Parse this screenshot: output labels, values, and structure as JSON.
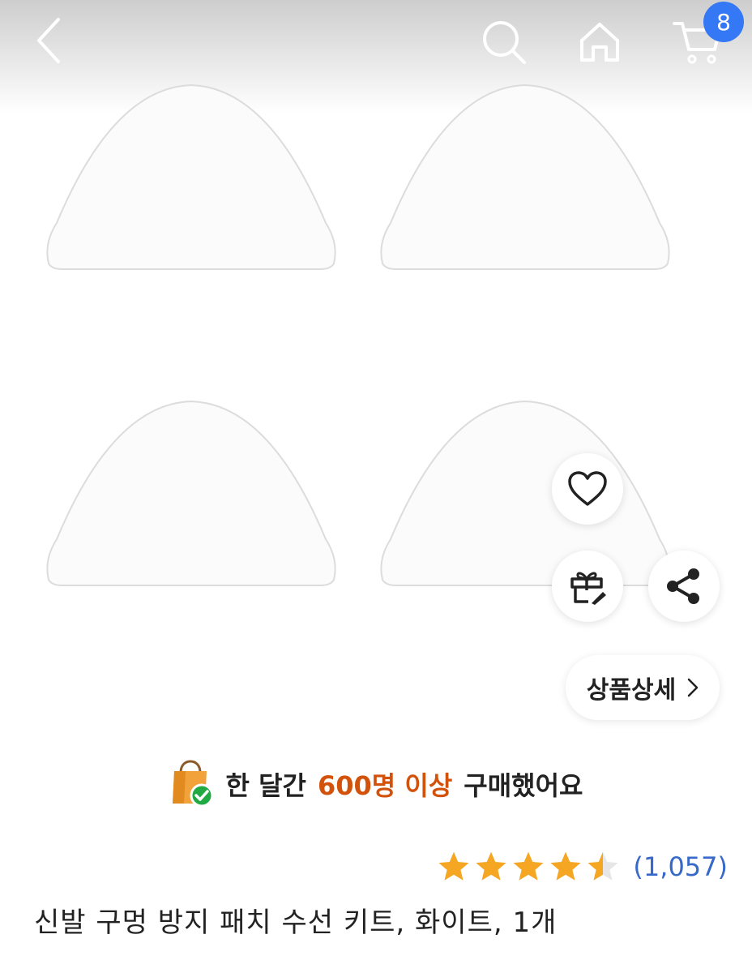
{
  "header": {
    "back_icon": "chevron-left-icon",
    "search_icon": "search-icon",
    "home_icon": "home-icon",
    "cart_icon": "cart-icon",
    "cart_count": "8",
    "badge_color": "#3478f6"
  },
  "actions": {
    "like_icon": "heart-icon",
    "gift_icon": "gift-icon",
    "share_icon": "share-icon",
    "detail_label": "상품상세",
    "detail_chevron": "›"
  },
  "social_proof": {
    "icon": "shopping-bag-check-icon",
    "text_before": "한 달간",
    "highlight": "600명 이상",
    "text_after": "구매했어요",
    "highlight_color": "#d3520b"
  },
  "rating": {
    "stars": 4.5,
    "star_color": "#f5a623",
    "review_count": "(1,057)"
  },
  "product": {
    "title": "신발 구멍 방지 패치 수선 키트, 화이트, 1개"
  }
}
